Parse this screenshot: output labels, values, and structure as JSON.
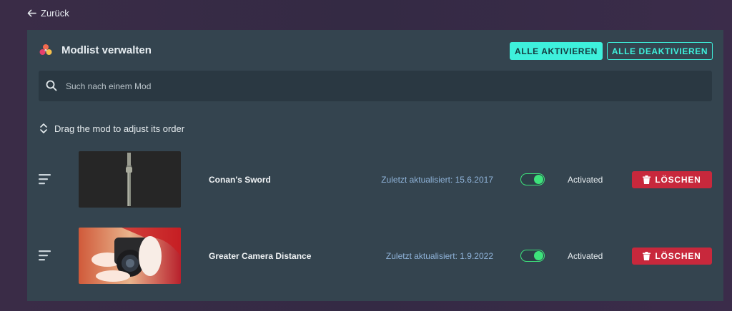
{
  "nav": {
    "back_label": "Zurück"
  },
  "header": {
    "title": "Modlist verwalten",
    "activate_all": "ALLE AKTIVIEREN",
    "deactivate_all": "ALLE DEAKTIVIEREN"
  },
  "search": {
    "placeholder": "Such nach einem Mod",
    "value": ""
  },
  "hint": "Drag the mod to adjust its order",
  "mods": [
    {
      "name": "Conan's Sword",
      "updated": "Zuletzt aktualisiert: 15.6.2017",
      "enabled": true,
      "status": "Activated",
      "delete_label": "LÖSCHEN"
    },
    {
      "name": "Greater Camera Distance",
      "updated": "Zuletzt aktualisiert: 1.9.2022",
      "enabled": true,
      "status": "Activated",
      "delete_label": "LÖSCHEN"
    }
  ],
  "colors": {
    "accent": "#3ef0dc",
    "toggle_on": "#3de27b",
    "delete": "#c8283c",
    "date_text": "#8fb3d9",
    "panel": "#34444f"
  }
}
